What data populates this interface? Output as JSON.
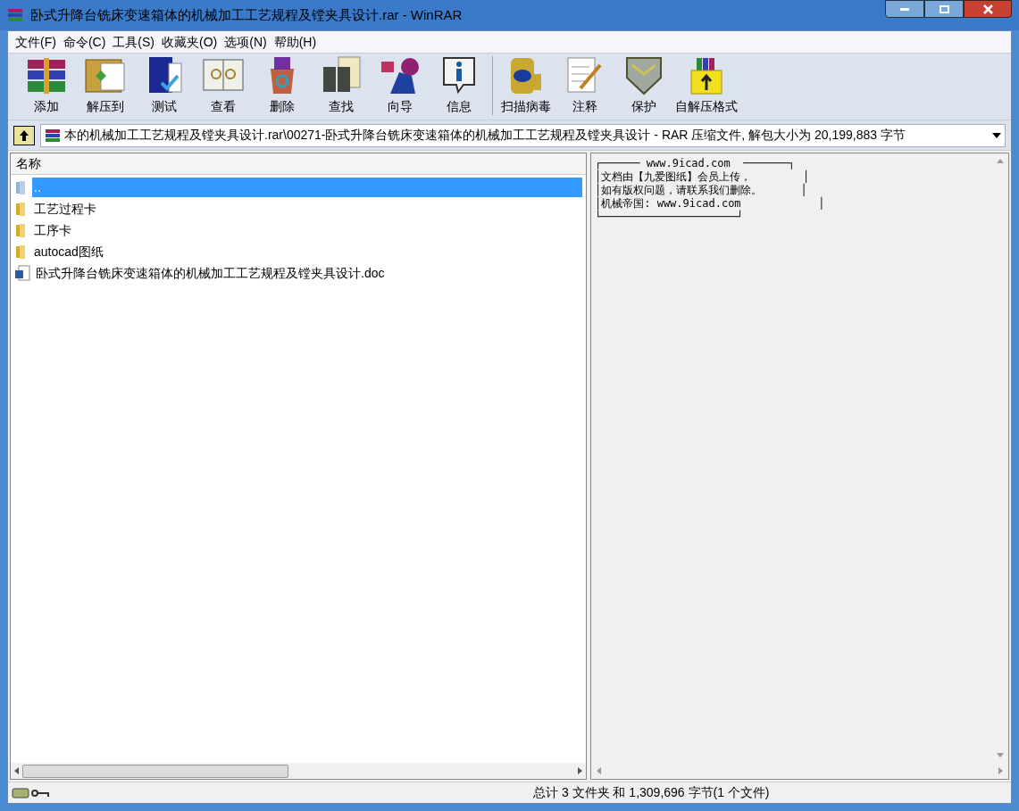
{
  "window": {
    "title": "卧式升降台铣床变速箱体的机械加工工艺规程及镗夹具设计.rar - WinRAR"
  },
  "menu": [
    "文件(F)",
    "命令(C)",
    "工具(S)",
    "收藏夹(O)",
    "选项(N)",
    "帮助(H)"
  ],
  "toolbar": [
    {
      "kind": "add",
      "label": "添加"
    },
    {
      "kind": "extract",
      "label": "解压到"
    },
    {
      "kind": "test",
      "label": "测试"
    },
    {
      "kind": "view",
      "label": "查看"
    },
    {
      "kind": "delete",
      "label": "删除"
    },
    {
      "kind": "find",
      "label": "查找"
    },
    {
      "kind": "wizard",
      "label": "向导"
    },
    {
      "kind": "info",
      "label": "信息"
    },
    {
      "kind": "virus",
      "label": "扫描病毒"
    },
    {
      "kind": "comment",
      "label": "注释"
    },
    {
      "kind": "protect",
      "label": "保护"
    },
    {
      "kind": "sfx",
      "label": "自解压格式"
    }
  ],
  "address": "本的机械加工工艺规程及镗夹具设计.rar\\00271-卧式升降台铣床变速箱体的机械加工工艺规程及镗夹具设计 - RAR 压缩文件, 解包大小为 20,199,883 字节",
  "file_list": {
    "columns": [
      "名称"
    ],
    "rows": [
      {
        "kind": "up",
        "name": "..",
        "selected": true
      },
      {
        "kind": "folder",
        "name": "工艺过程卡",
        "selected": false
      },
      {
        "kind": "folder",
        "name": "工序卡",
        "selected": false
      },
      {
        "kind": "folder",
        "name": "autocad图纸",
        "selected": false
      },
      {
        "kind": "doc",
        "name": "卧式升降台铣床变速箱体的机械加工工艺规程及镗夹具设计.doc",
        "selected": false
      }
    ]
  },
  "comment": [
    "┌────── www.9icad.com  ───────┐",
    "│文档由【九爱图纸】会员上传，        │",
    "│如有版权问题，请联系我们删除。      │",
    "│机械帝国: www.9icad.com            │",
    "└─────────────────────┘"
  ],
  "status_bar": {
    "text": "总计 3 文件夹 和 1,309,696 字节(1 个文件)"
  }
}
